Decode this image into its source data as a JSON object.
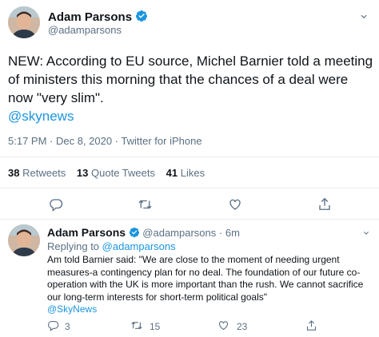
{
  "main_tweet": {
    "author": "Adam Parsons",
    "handle": "@adamparsons",
    "text": "NEW: According to EU source, Michel Barnier told a meeting of ministers this morning that the chances of a deal were now \"very slim\".",
    "mention": "@skynews",
    "meta": "5:17 PM · Dec 8, 2020 · Twitter for iPhone",
    "stats": {
      "retweets_count": "38",
      "retweets_label": "Retweets",
      "quotes_count": "13",
      "quotes_label": "Quote Tweets",
      "likes_count": "41",
      "likes_label": "Likes"
    }
  },
  "reply_tweet": {
    "author": "Adam Parsons",
    "handle": "@adamparsons",
    "separator": "·",
    "time": "6m",
    "replying_prefix": "Replying to",
    "replying_handle": "@adamparsons",
    "text": "Am told Barnier said: \"We are close to the moment of needing urgent measures-a contingency plan for no deal. The foundation of our future co-operation with the UK is more important than the rush. We cannot sacrifice our long-term interests for short-term political goals\"",
    "mention": "@SkyNews",
    "actions": {
      "reply_count": "3",
      "retweet_count": "15",
      "like_count": "23"
    }
  },
  "colors": {
    "accent": "#1b95e0",
    "muted": "#5b7083",
    "divider": "#e6ecf0"
  },
  "icons": [
    "verified-badge-icon",
    "reply-icon",
    "retweet-icon",
    "like-icon",
    "share-icon",
    "chevron-down-icon"
  ]
}
